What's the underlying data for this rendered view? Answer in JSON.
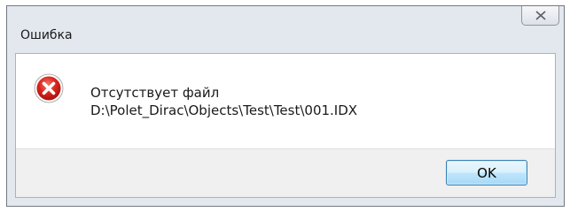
{
  "window": {
    "title": "Ошибка",
    "close_icon": "close-icon"
  },
  "dialog": {
    "icon": "error-icon",
    "message_line1": "Отсутствует файл",
    "message_line2": "D:\\Polet_Dirac\\Objects\\Test\\Test\\001.IDX"
  },
  "buttons": {
    "ok_label": "OK"
  },
  "colors": {
    "error_red": "#d9251c",
    "button_border": "#3c7fb1"
  }
}
